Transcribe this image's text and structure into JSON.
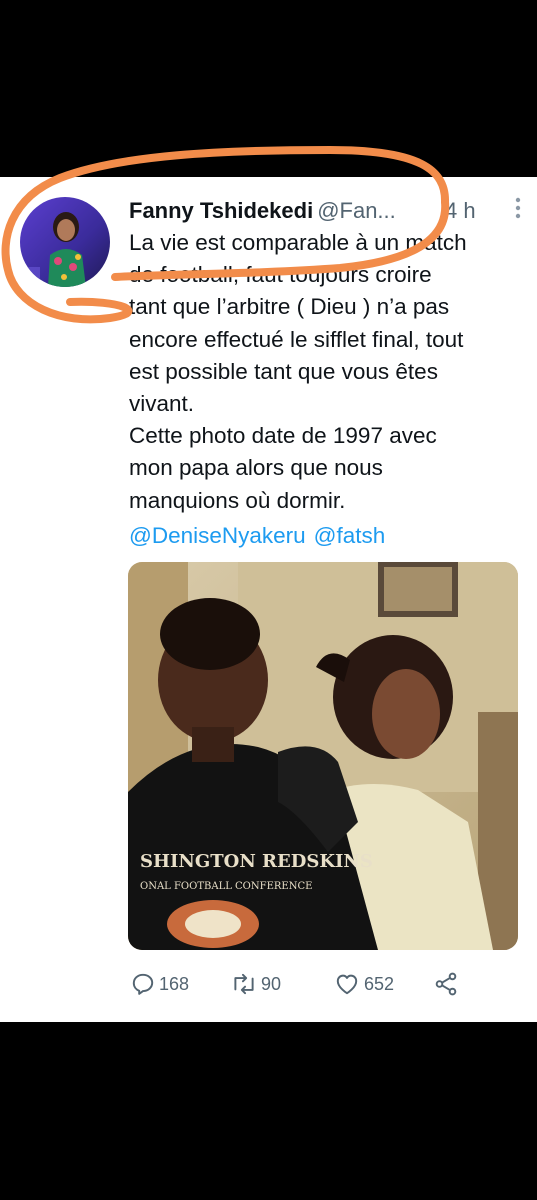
{
  "tweet": {
    "display_name": "Fanny Tshidekedi",
    "handle": "@Fan...",
    "time": "4 h",
    "more_icon": "more-vertical-icon",
    "text": "La vie est comparable à un match\nde football, faut toujours croire\ntant que l’arbitre ( Dieu ) n’a pas\nencore effectué le sifflet final, tout\nest possible tant que vous êtes\nvivant.\nCette photo date de 1997 avec\nmon papa alors que nous\nmanquions où dormir.",
    "mentions": [
      "@DeniseNyakeru",
      "@fatsh"
    ],
    "photo_shirt_text": [
      "SHINGTON REDSKINS",
      "ONAL FOOTBALL CONFERENCE"
    ]
  },
  "actions": {
    "reply": {
      "icon": "reply-icon",
      "count": "168"
    },
    "retweet": {
      "icon": "retweet-icon",
      "count": "90"
    },
    "like": {
      "icon": "heart-icon",
      "count": "652"
    },
    "share": {
      "icon": "share-icon"
    }
  },
  "colors": {
    "annotation_stroke": "#f28c4a",
    "link": "#1d9bf0",
    "secondary_text": "#536471",
    "primary_text": "#0f1419"
  }
}
